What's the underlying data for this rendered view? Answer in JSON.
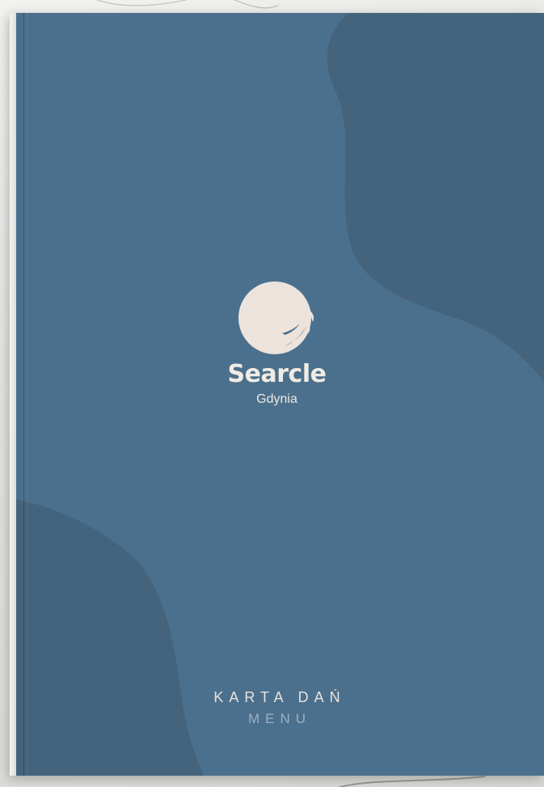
{
  "cover": {
    "brand_name": "Searcle",
    "city": "Gdynia",
    "title_primary": "KARTA DAŃ",
    "title_secondary": "MENU",
    "logo_icon": "circle-logo-icon"
  },
  "colors": {
    "cover_blue": "#4b708d",
    "cover_blue_dark": "#44637c",
    "logo_cream": "#ebe3dc",
    "text_light": "#f1ebe4",
    "text_muted": "#9fb0bf"
  }
}
